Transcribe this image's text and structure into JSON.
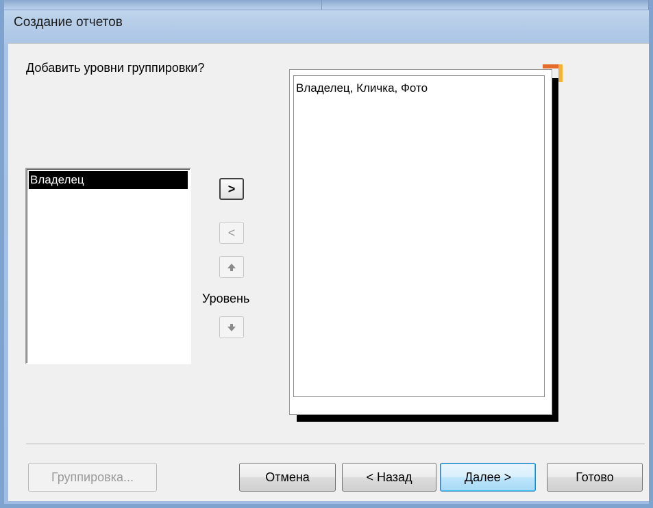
{
  "window": {
    "title": "Создание отчетов"
  },
  "wizard": {
    "question": "Добавить уровни группировки?",
    "fields": [
      "Владелец"
    ],
    "level_label": "Уровень",
    "preview_text": "Владелец, Кличка, Фото"
  },
  "nav_buttons": {
    "add": ">",
    "remove": "<"
  },
  "footer": {
    "grouping_label": "Группировка...",
    "cancel_label": "Отмена",
    "back_label": "< Назад",
    "next_label": "Далее >",
    "finish_label": "Готово"
  },
  "icons": {
    "move_up": "arrow-up-icon",
    "move_down": "arrow-down-icon"
  }
}
